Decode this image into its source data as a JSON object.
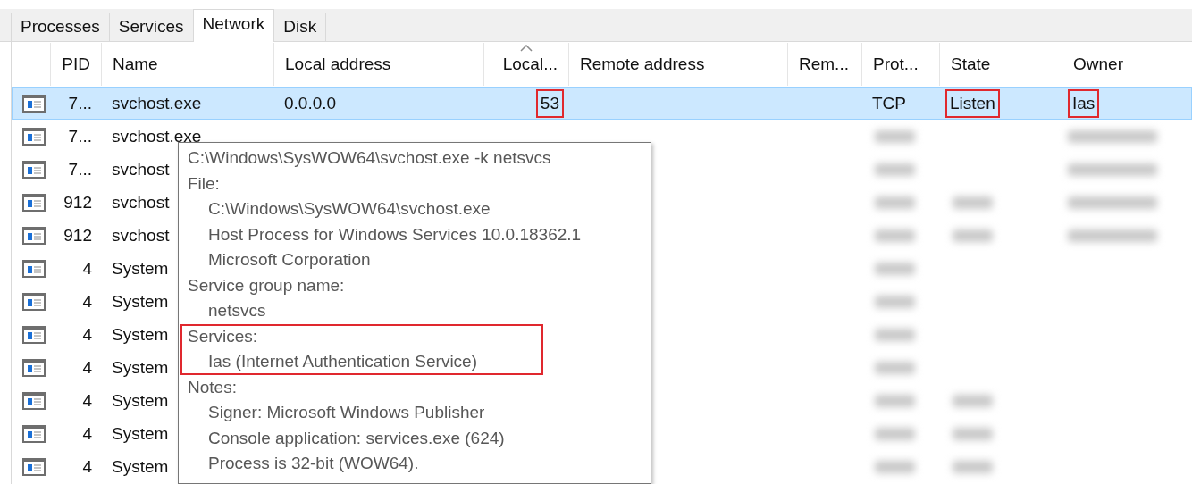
{
  "tabs": [
    {
      "label": "Processes",
      "selected": false
    },
    {
      "label": "Services",
      "selected": false
    },
    {
      "label": "Network",
      "selected": true
    },
    {
      "label": "Disk",
      "selected": false
    }
  ],
  "table": {
    "columns": [
      {
        "label": "PID",
        "sorted": false
      },
      {
        "label": "Name",
        "sorted": false
      },
      {
        "label": "Local address",
        "sorted": false
      },
      {
        "label": "Local...",
        "sorted": true
      },
      {
        "label": "Remote address",
        "sorted": false
      },
      {
        "label": "Rem...",
        "sorted": false
      },
      {
        "label": "Prot...",
        "sorted": false
      },
      {
        "label": "State",
        "sorted": false
      },
      {
        "label": "Owner",
        "sorted": false
      }
    ],
    "rows": [
      {
        "selected": true,
        "cells": [
          {
            "text": "7..."
          },
          {
            "text": "svchost.exe"
          },
          {
            "text": "0.0.0.0"
          },
          {
            "text": "53",
            "highlighted": true
          },
          null,
          null,
          {
            "text": "TCP"
          },
          {
            "text": "Listen",
            "highlighted": true
          },
          {
            "text": "Ias",
            "highlighted": true
          }
        ]
      },
      {
        "selected": false,
        "cells": [
          {
            "text": "7..."
          },
          {
            "text": "svchost.exe"
          }
        ]
      },
      {
        "selected": false,
        "cells": [
          {
            "text": "7..."
          },
          {
            "text": "svchost"
          }
        ]
      },
      {
        "selected": false,
        "cells": [
          {
            "text": "912"
          },
          {
            "text": "svchost"
          }
        ]
      },
      {
        "selected": false,
        "cells": [
          {
            "text": "912"
          },
          {
            "text": "svchost"
          }
        ]
      },
      {
        "selected": false,
        "cells": [
          {
            "text": "4"
          },
          {
            "text": "System"
          }
        ]
      },
      {
        "selected": false,
        "cells": [
          {
            "text": "4"
          },
          {
            "text": "System"
          }
        ]
      },
      {
        "selected": false,
        "cells": [
          {
            "text": "4"
          },
          {
            "text": "System"
          }
        ]
      },
      {
        "selected": false,
        "cells": [
          {
            "text": "4"
          },
          {
            "text": "System"
          }
        ]
      },
      {
        "selected": false,
        "cells": [
          {
            "text": "4"
          },
          {
            "text": "System"
          }
        ]
      },
      {
        "selected": false,
        "cells": [
          {
            "text": "4"
          },
          {
            "text": "System"
          }
        ]
      },
      {
        "selected": false,
        "cells": [
          {
            "text": "4"
          },
          {
            "text": "System"
          }
        ]
      }
    ]
  },
  "tooltip": {
    "command_line": "C:\\Windows\\SysWOW64\\svchost.exe -k netsvcs",
    "sections": [
      {
        "title": "File:",
        "highlighted": false,
        "lines": [
          "C:\\Windows\\SysWOW64\\svchost.exe",
          "Host Process for Windows Services 10.0.18362.1",
          "Microsoft Corporation"
        ]
      },
      {
        "title": "Service group name:",
        "highlighted": false,
        "lines": [
          "netsvcs"
        ]
      },
      {
        "title": "Services:",
        "highlighted": true,
        "lines": [
          "Ias (Internet Authentication Service)"
        ]
      },
      {
        "title": "Notes:",
        "highlighted": false,
        "lines": [
          "Signer: Microsoft Windows Publisher",
          "Console application: services.exe (624)",
          "Process is 32-bit (WOW64)."
        ]
      }
    ]
  }
}
